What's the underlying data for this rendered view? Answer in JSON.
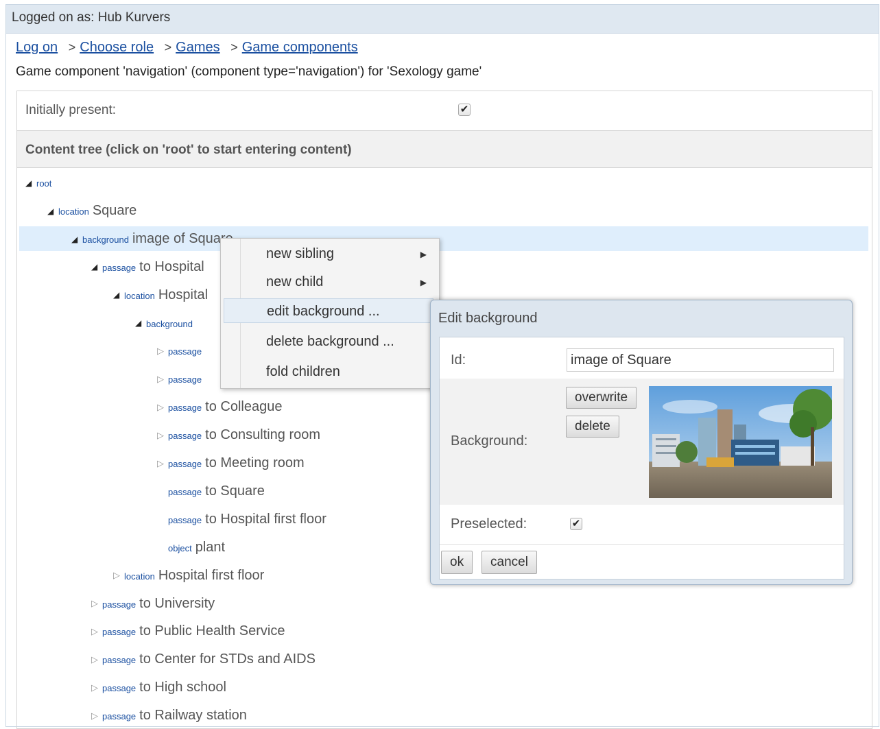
{
  "login": {
    "text": "Logged on as: Hub Kurvers"
  },
  "breadcrumb": {
    "items": [
      "Log on",
      "Choose role",
      "Games",
      "Game components"
    ],
    "separator": ">"
  },
  "subtitle": "Game component 'navigation' (component type='navigation') for 'Sexology game'",
  "initially_present": {
    "label": "Initially present:",
    "checked": true,
    "check_glyph": "✔"
  },
  "content_tree": {
    "header": "Content tree (click on 'root' to start entering content)",
    "nodes": [
      {
        "type": "root",
        "label": "",
        "state": "open"
      },
      {
        "type": "location",
        "label": "Square",
        "state": "open"
      },
      {
        "type": "background",
        "label": "image of Square",
        "state": "open",
        "selected": true
      },
      {
        "type": "passage",
        "label": "to Hospital",
        "state": "open"
      },
      {
        "type": "location",
        "label": "Hospital",
        "state": "open"
      },
      {
        "type": "background",
        "label": "",
        "state": "open"
      },
      {
        "type": "passage",
        "label": "",
        "state": "closed"
      },
      {
        "type": "passage",
        "label": "",
        "state": "closed"
      },
      {
        "type": "passage",
        "label": "to Colleague",
        "state": "closed"
      },
      {
        "type": "passage",
        "label": "to Consulting room",
        "state": "closed"
      },
      {
        "type": "passage",
        "label": "to Meeting room",
        "state": "closed"
      },
      {
        "type": "passage",
        "label": "to Square",
        "state": "leaf"
      },
      {
        "type": "passage",
        "label": "to Hospital first floor",
        "state": "leaf"
      },
      {
        "type": "object",
        "label": "plant",
        "state": "leaf"
      },
      {
        "type": "location",
        "label": "Hospital first floor",
        "state": "closed"
      },
      {
        "type": "passage",
        "label": "to University",
        "state": "closed"
      },
      {
        "type": "passage",
        "label": "to Public Health Service",
        "state": "closed"
      },
      {
        "type": "passage",
        "label": "to Center for STDs and AIDS",
        "state": "closed"
      },
      {
        "type": "passage",
        "label": "to High school",
        "state": "closed"
      },
      {
        "type": "passage",
        "label": "to Railway station",
        "state": "closed"
      }
    ]
  },
  "context_menu": {
    "items": [
      {
        "label": "new sibling",
        "submenu": true
      },
      {
        "label": "new child",
        "submenu": true
      },
      {
        "label": "edit background ...",
        "submenu": false,
        "hover": true
      },
      {
        "label": "delete background ...",
        "submenu": false
      },
      {
        "label": "fold children",
        "submenu": false
      }
    ]
  },
  "dialog": {
    "title": "Edit background",
    "id_label": "Id:",
    "id_value": "image of Square",
    "background_label": "Background:",
    "overwrite_label": "overwrite",
    "delete_label": "delete",
    "preselected_label": "Preselected:",
    "preselected_checked": true,
    "ok_label": "ok",
    "cancel_label": "cancel"
  },
  "icons": {
    "open_toggle": "◢",
    "closed_toggle": "▷",
    "submenu_arrow": "▶",
    "check": "✔"
  }
}
